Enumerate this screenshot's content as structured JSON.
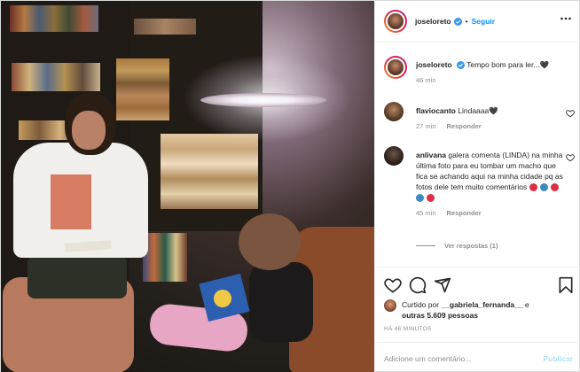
{
  "post": {
    "author": "joseloreto",
    "follow_label": "Seguir",
    "separator": "•"
  },
  "caption": {
    "username": "joseloreto",
    "text": "Tempo bom para ler...",
    "heart": "🖤",
    "time": "46 min"
  },
  "comments": [
    {
      "username": "flaviocanto",
      "text": "Lindaaaa",
      "heart": "🖤",
      "time": "27 min",
      "reply_label": "Responder"
    },
    {
      "username": "anlivana",
      "text": "galera comenta (LINDA) na minha última foto para eu tombar um macho que fica se achando aqui na minha cidade pq as fotos dele tem muito comentários",
      "emoji_colors": [
        "#dd2e44",
        "#3b88c3",
        "#dd2e44",
        "#3b88c3",
        "#dd2e44"
      ],
      "time": "45 min",
      "reply_label": "Responder",
      "view_replies": "Ver respostas (1)"
    }
  ],
  "likes": {
    "prefix": "Curtido por",
    "user": "__gabriela_fernanda__",
    "connector": "e",
    "others": "outras 5.609 pessoas"
  },
  "posted_ago": "HÁ 46 MINUTOS",
  "add_comment": {
    "placeholder": "Adicione um comentário...",
    "publish_label": "Publicar"
  },
  "colors": {
    "link_blue": "#0095f6",
    "publish_disabled": "#b2dffc",
    "muted": "#8e8e8e",
    "text": "#262626"
  },
  "icons": [
    "heart-icon",
    "comment-icon",
    "share-icon",
    "bookmark-icon",
    "more-icon",
    "verified-badge-icon"
  ]
}
